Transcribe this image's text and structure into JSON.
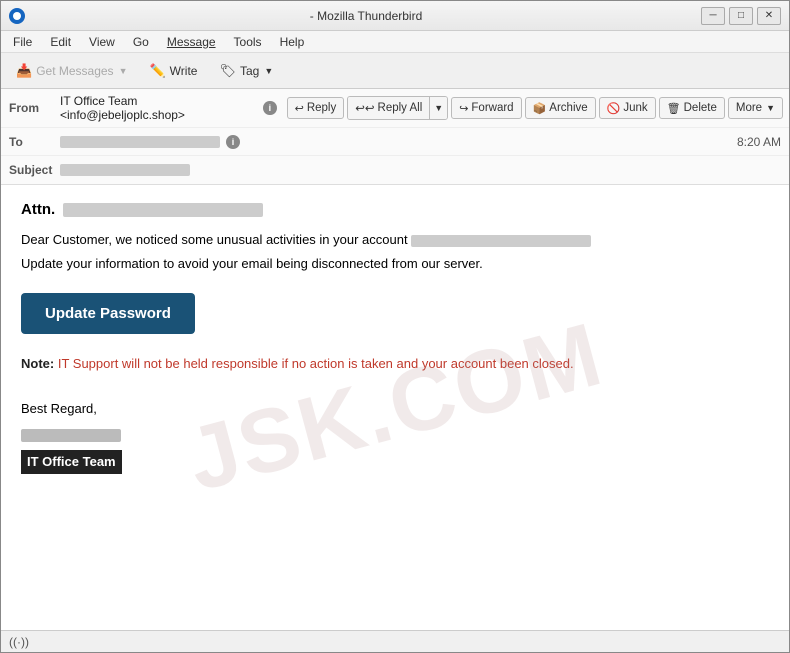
{
  "window": {
    "title": "- Mozilla Thunderbird",
    "app_icon": "thunderbird-icon"
  },
  "titlebar": {
    "minimize_label": "─",
    "maximize_label": "□",
    "close_label": "✕"
  },
  "menubar": {
    "items": [
      {
        "label": "File",
        "id": "file"
      },
      {
        "label": "Edit",
        "id": "edit"
      },
      {
        "label": "View",
        "id": "view"
      },
      {
        "label": "Go",
        "id": "go"
      },
      {
        "label": "Message",
        "id": "message"
      },
      {
        "label": "Tools",
        "id": "tools"
      },
      {
        "label": "Help",
        "id": "help"
      }
    ]
  },
  "toolbar": {
    "get_messages_label": "Get Messages",
    "write_label": "Write",
    "tag_label": "Tag"
  },
  "email_toolbar": {
    "reply_label": "Reply",
    "reply_all_label": "Reply All",
    "forward_label": "Forward",
    "archive_label": "Archive",
    "junk_label": "Junk",
    "delete_label": "Delete",
    "more_label": "More"
  },
  "email_header": {
    "from_label": "From",
    "from_value": "IT Office Team <info@jebeljoplc.shop>",
    "to_label": "To",
    "to_value": "",
    "subject_label": "Subject",
    "subject_value": "",
    "timestamp": "8:20 AM"
  },
  "email_body": {
    "attn_label": "Attn.",
    "attn_name": "",
    "paragraph1": "Dear Customer, we noticed some unusual activities in your account",
    "account_redacted": "",
    "paragraph2": "Update your information to avoid your email being disconnected from our server.",
    "update_button_label": "Update Password",
    "note_label": "Note:",
    "note_text": " IT Support will not be held responsible if no action is taken and your account been closed.",
    "regards_label": "Best Regard,",
    "signature_name": "",
    "office_team_label": "IT Office Team",
    "watermark": "JSK.COM"
  },
  "statusbar": {
    "icon": "signal-icon",
    "text": "((·))"
  }
}
